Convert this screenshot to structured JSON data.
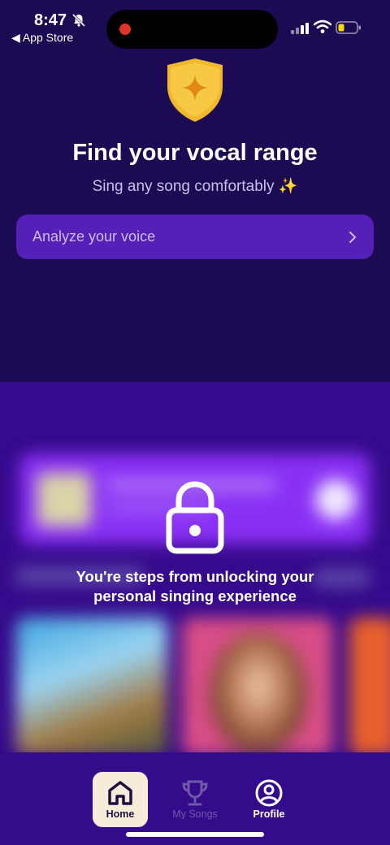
{
  "status_bar": {
    "time": "8:47",
    "back_app": "◀ App Store"
  },
  "hero": {
    "title": "Find your vocal range",
    "subtitle": "Sing any song comfortably ✨",
    "analyze_button": "Analyze your voice"
  },
  "locked": {
    "message": "You're steps from unlocking your personal singing experience"
  },
  "tabs": [
    {
      "label": "Home",
      "icon": "home-icon",
      "active": true
    },
    {
      "label": "My Songs",
      "icon": "trophy-icon",
      "active": false
    },
    {
      "label": "Profile",
      "icon": "profile-icon",
      "active": false
    }
  ],
  "colors": {
    "background": "#1c0a52",
    "button": "#5520b8",
    "locked_area": "#360a8c",
    "tab_bar": "#340b8a",
    "active_tab": "#f6ecd9"
  }
}
